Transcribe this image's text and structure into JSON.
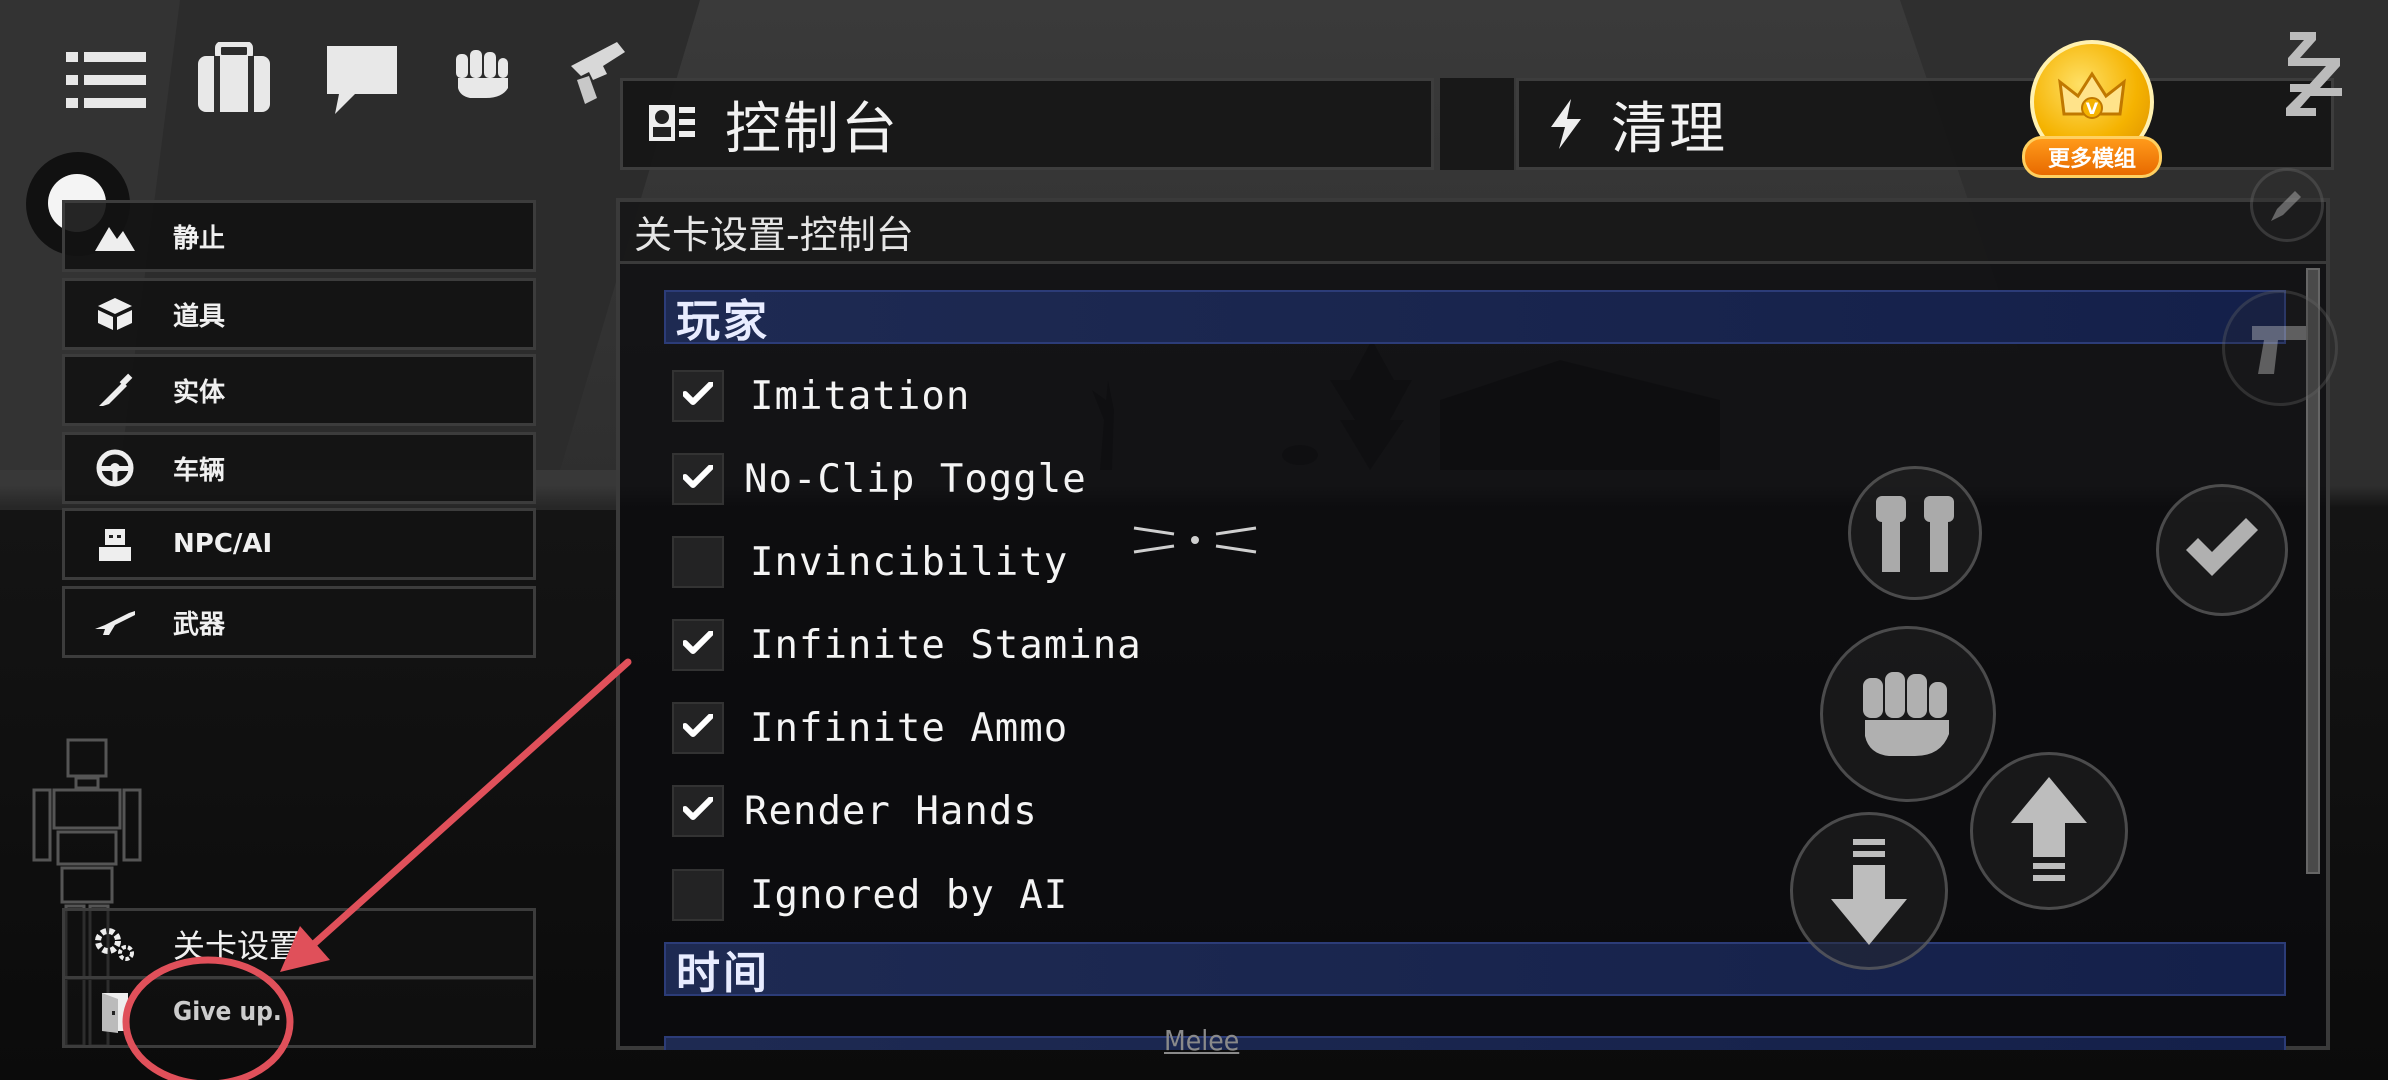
{
  "toolbar": {
    "icons": [
      "menu-icon",
      "briefcase-icon",
      "chat-icon",
      "fist-icon",
      "hand-pistol-icon"
    ]
  },
  "tabs": [
    {
      "label": "控制台",
      "icon": "console-icon"
    },
    {
      "label": "清理",
      "icon": "lightning-icon"
    }
  ],
  "mod_badge": {
    "label": "更多模组"
  },
  "sidebar": {
    "items": [
      {
        "label": "静止",
        "icon": "mountain-icon"
      },
      {
        "label": "道具",
        "icon": "box-icon"
      },
      {
        "label": "实体",
        "icon": "syringe-icon"
      },
      {
        "label": "车辆",
        "icon": "steering-wheel-icon"
      },
      {
        "label": "NPC/AI",
        "icon": "npc-icon"
      },
      {
        "label": "武器",
        "icon": "rifle-icon"
      }
    ],
    "bottom": [
      {
        "label": "关卡设置",
        "icon": "gears-icon"
      },
      {
        "label": "Give up.",
        "icon": "exit-door-icon"
      }
    ]
  },
  "panel": {
    "title": "关卡设置-控制台",
    "sections": [
      {
        "header": "玩家",
        "options": [
          {
            "label": "Imitation",
            "checked": true
          },
          {
            "label": "No-Clip Toggle",
            "checked": true
          },
          {
            "label": "Invincibility",
            "checked": false
          },
          {
            "label": "Infinite Stamina",
            "checked": true
          },
          {
            "label": "Infinite Ammo",
            "checked": true
          },
          {
            "label": "Render Hands",
            "checked": true
          },
          {
            "label": "Ignored by AI",
            "checked": false
          }
        ]
      },
      {
        "header": "时间",
        "options": []
      }
    ]
  },
  "hud": {
    "melee_label": "Melee"
  },
  "colors": {
    "section_header_bg": "#1e2a52",
    "annotation_red": "#e0505a",
    "badge_gold": "#f5b301"
  }
}
